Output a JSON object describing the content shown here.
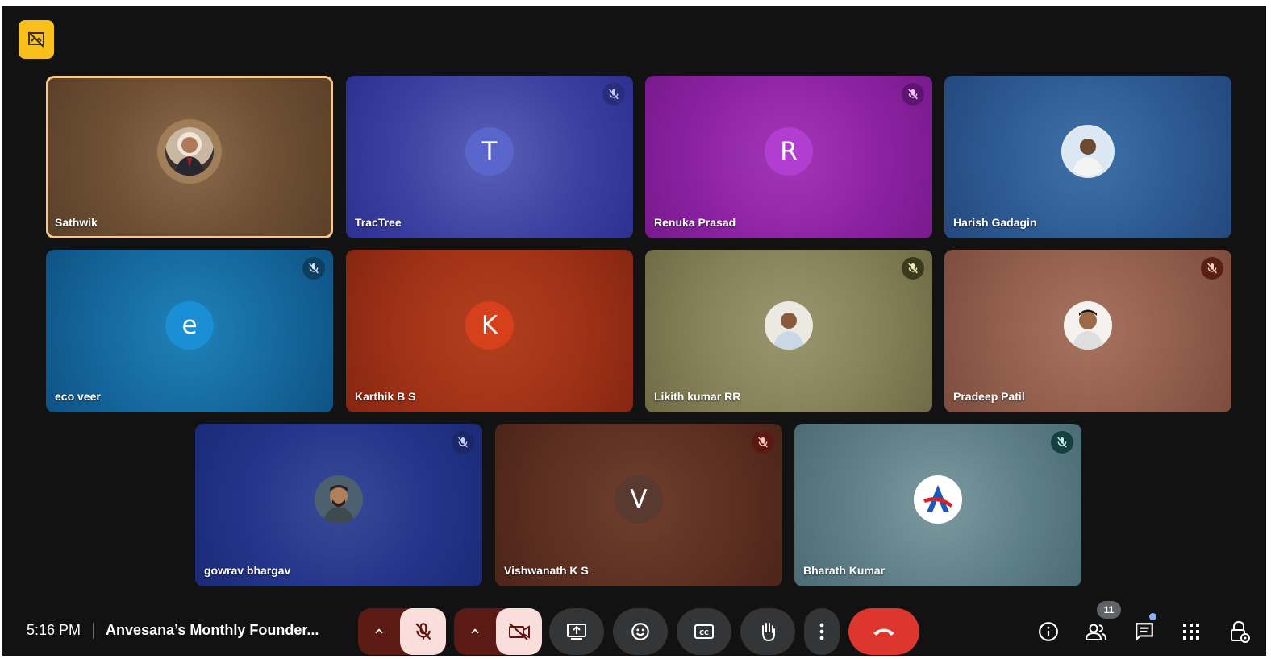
{
  "participants": [
    {
      "name": "Sathwik",
      "initial": "",
      "muted": false,
      "active": true
    },
    {
      "name": "TracTree",
      "initial": "T",
      "muted": true
    },
    {
      "name": "Renuka Prasad",
      "initial": "R",
      "muted": true
    },
    {
      "name": "Harish Gadagin",
      "initial": "",
      "muted": false
    },
    {
      "name": "eco veer",
      "initial": "e",
      "muted": true
    },
    {
      "name": "Karthik B S",
      "initial": "K",
      "muted": false
    },
    {
      "name": "Likith kumar RR",
      "initial": "",
      "muted": true
    },
    {
      "name": "Pradeep Patil",
      "initial": "",
      "muted": true
    },
    {
      "name": "gowrav bhargav",
      "initial": "",
      "muted": true
    },
    {
      "name": "Vishwanath K S",
      "initial": "V",
      "muted": true
    },
    {
      "name": "Bharath Kumar",
      "initial": "",
      "muted": true
    }
  ],
  "bottombar": {
    "time": "5:16 PM",
    "meeting_title": "Anvesana’s Monthly Founder...",
    "participant_count": "11"
  },
  "colors": {
    "background": "#121212",
    "end_call": "#dc362e",
    "alert": "#f9bf1d",
    "mic_off_bg": "#f9dedc"
  },
  "icons": [
    "hidden-video-alert-icon",
    "mic-off-icon",
    "video-off-icon",
    "present-screen-icon",
    "emoji-icon",
    "captions-icon",
    "raise-hand-icon",
    "more-options-icon",
    "end-call-icon",
    "info-icon",
    "people-icon",
    "chat-icon",
    "activities-icon",
    "host-controls-icon"
  ]
}
